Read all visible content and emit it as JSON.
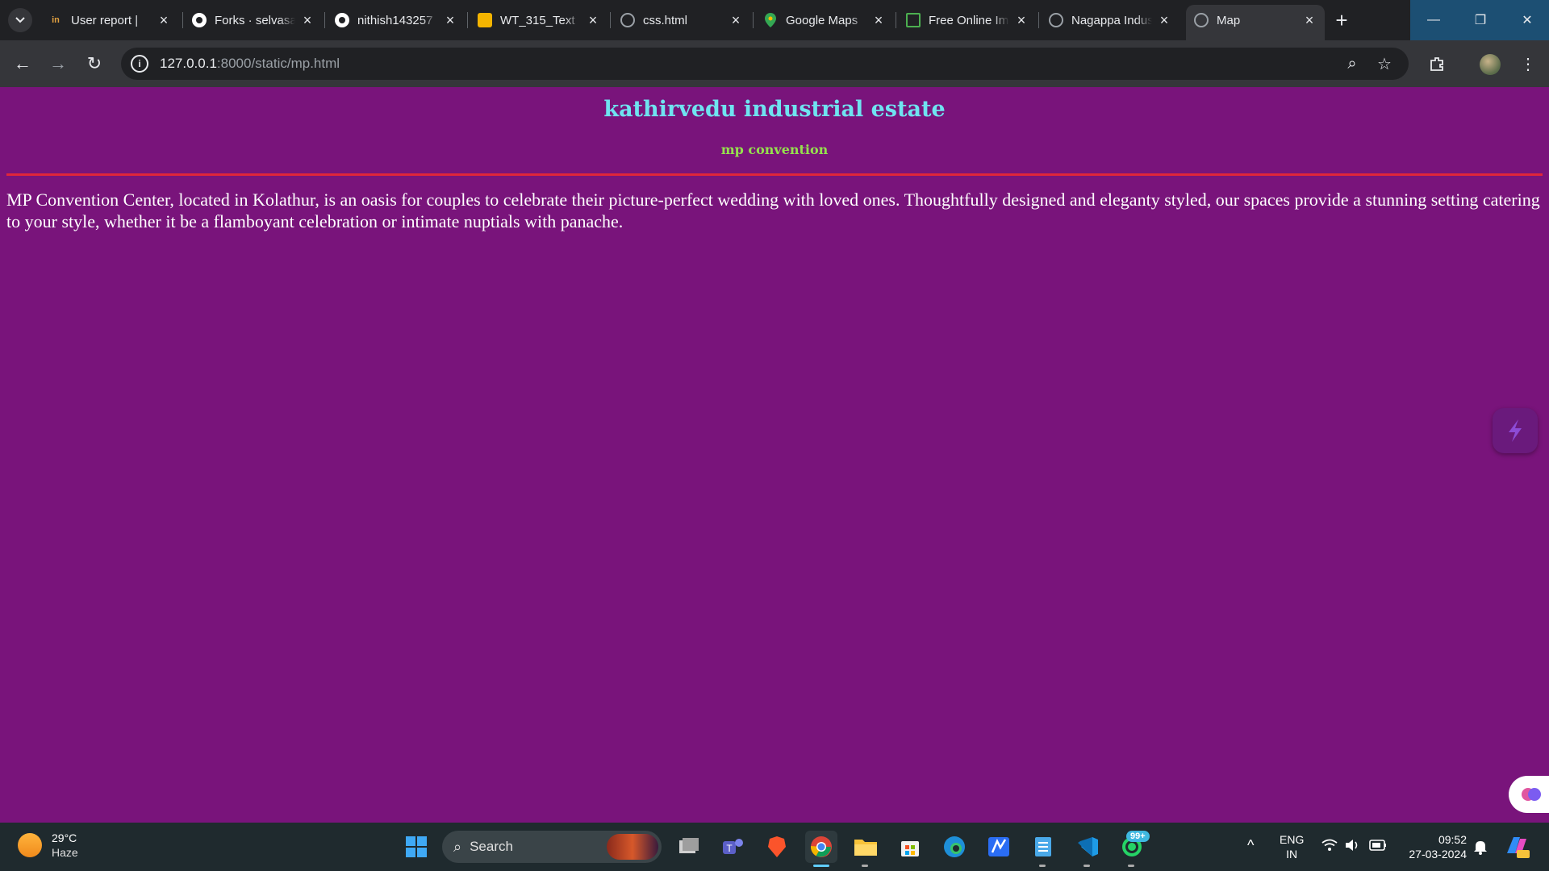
{
  "browser": {
    "tabs": [
      {
        "title": "User report | ",
        "favicon": "in-logo-icon",
        "color": "#e0a040"
      },
      {
        "title": "Forks · selvasankar",
        "favicon": "github-icon",
        "color": "#ffffff"
      },
      {
        "title": "nithish143257",
        "favicon": "github-icon",
        "color": "#ffffff"
      },
      {
        "title": "WT_315_Text",
        "favicon": "slides-icon",
        "color": "#f4b400"
      },
      {
        "title": "css.html",
        "favicon": "globe-icon",
        "color": "#9aa0a6"
      },
      {
        "title": "Google Maps",
        "favicon": "maps-pin-icon",
        "color": "#34a853"
      },
      {
        "title": "Free Online Image",
        "favicon": "image-icon",
        "color": "#4caf50"
      },
      {
        "title": "Nagappa Industrial",
        "favicon": "globe-icon",
        "color": "#9aa0a6"
      },
      {
        "title": "Map",
        "favicon": "globe-icon",
        "color": "#9aa0a6"
      }
    ],
    "url_host": "127.0.0.1",
    "url_path": ":8000/static/mp.html"
  },
  "page": {
    "title": "kathirvedu industrial estate",
    "subtitle": "mp convention",
    "paragraph": "MP Convention Center, located in Kolathur, is an oasis for couples to celebrate their picture-perfect wedding with loved ones. Thoughtfully designed and eleganty styled, our spaces provide a stunning setting catering to your style, whether it be a flamboyant celebration or intimate nuptials with panache.",
    "background_color": "#79147b",
    "title_color": "#6fe3f0",
    "subtitle_color": "#95e04e",
    "rule_color": "#e0263a"
  },
  "taskbar": {
    "weather_temp": "29°C",
    "weather_desc": "Haze",
    "search_label": "Search",
    "whatsapp_badge": "99+",
    "lang_line1": "ENG",
    "lang_line2": "IN",
    "time": "09:52",
    "date": "27-03-2024"
  }
}
